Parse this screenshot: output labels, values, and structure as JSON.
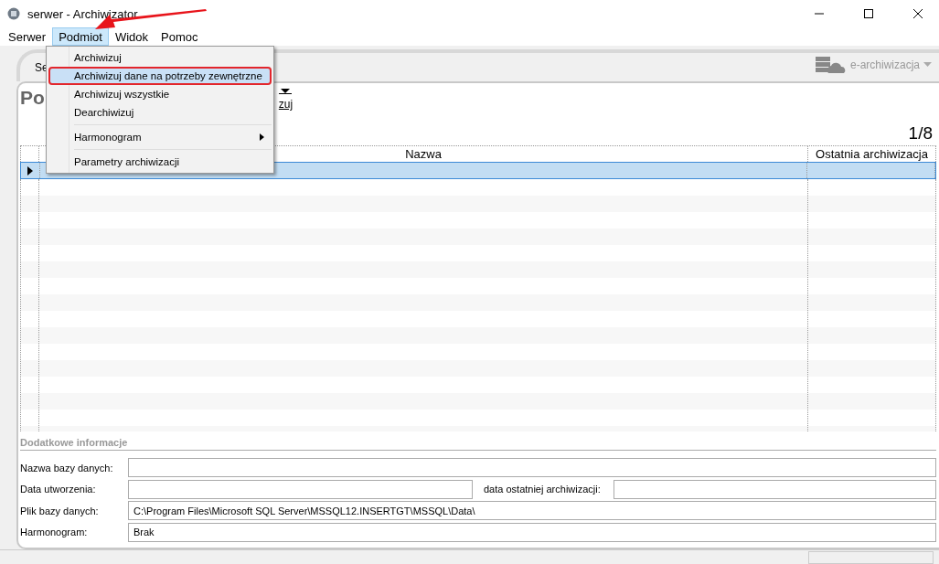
{
  "window": {
    "title": "serwer - Archiwizator"
  },
  "menu_bar": [
    {
      "label": "Serwer",
      "selected": false
    },
    {
      "label": "Podmiot",
      "selected": true
    },
    {
      "label": "Widok",
      "selected": false
    },
    {
      "label": "Pomoc",
      "selected": false
    }
  ],
  "dropdown_menu": [
    {
      "kind": "item",
      "label": "Archiwizuj",
      "selected": false
    },
    {
      "kind": "item",
      "label": "Archiwizuj dane na potrzeby zewnętrzne",
      "selected": true
    },
    {
      "kind": "item",
      "label": "Archiwizuj wszystkie",
      "selected": false
    },
    {
      "kind": "item",
      "label": "Dearchiwizuj",
      "selected": false
    },
    {
      "kind": "separator"
    },
    {
      "kind": "submenu",
      "label": "Harmonogram",
      "selected": false
    },
    {
      "kind": "separator"
    },
    {
      "kind": "item",
      "label": "Parametry archiwizacji",
      "selected": false
    }
  ],
  "tab": {
    "label": "Se"
  },
  "heading": "Po",
  "link": "zuj",
  "e_archive": {
    "label": "e-archiwizacja"
  },
  "page_count": "1/8",
  "table": {
    "columns": [
      "Nazwa",
      "Ostatnia archiwizacja"
    ],
    "rows": [
      {
        "selected": true
      }
    ]
  },
  "details": {
    "title": "Dodatkowe informacje",
    "rows": [
      {
        "fields": [
          {
            "label": "Nazwa bazy danych:"
          }
        ]
      },
      {
        "fields": [
          {
            "label": "Data utworzenia:"
          },
          {
            "label": "data ostatniej archiwizacji:"
          }
        ]
      },
      {
        "fields": [
          {
            "label": "Plik bazy danych:",
            "value": "C:\\Program Files\\Microsoft SQL Server\\MSSQL12.INSERTGT\\MSSQL\\Data\\"
          }
        ]
      },
      {
        "fields": [
          {
            "label": "Harmonogram:",
            "value": "Brak"
          }
        ]
      }
    ]
  }
}
